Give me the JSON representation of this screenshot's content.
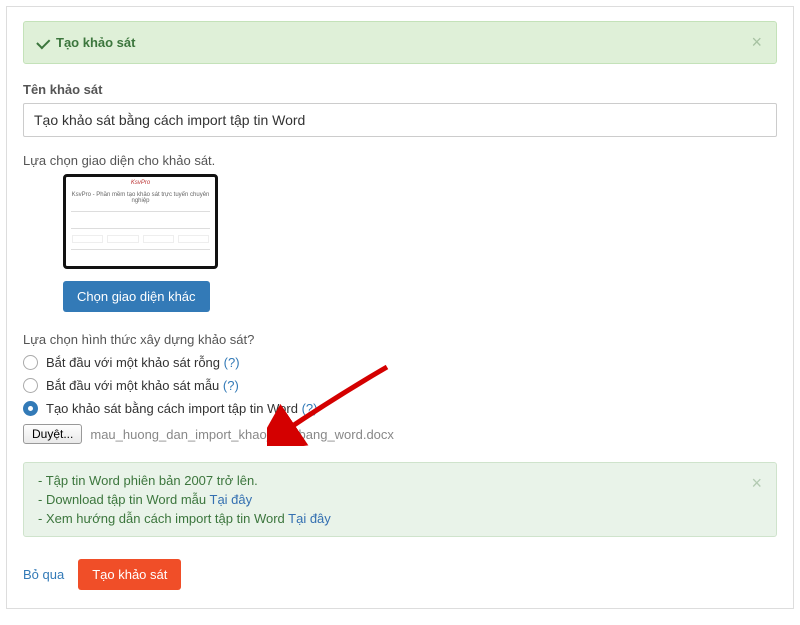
{
  "alert": {
    "title": "Tạo khảo sát"
  },
  "survey_name": {
    "label": "Tên khảo sát",
    "value": "Tạo khảo sát bằng cách import tập tin Word"
  },
  "template": {
    "label": "Lựa chọn giao diện cho khảo sát.",
    "button": "Chọn giao diện khác",
    "thumb_brand": "KsvPro",
    "thumb_title": "KsvPro - Phần mềm tạo khảo sát trực tuyến chuyên nghiệp"
  },
  "build": {
    "label": "Lựa chọn hình thức xây dựng khảo sát?",
    "opt1": "Bắt đầu với một khảo sát rỗng",
    "opt2": "Bắt đầu với một khảo sát mẫu",
    "opt3": "Tạo khảo sát bằng cách import tập tin Word",
    "help": "(?)"
  },
  "file": {
    "browse": "Duyệt...",
    "name": "mau_huong_dan_import_khao_sat_bang_word.docx"
  },
  "info": {
    "line1": "- Tập tin Word phiên bản 2007 trở lên.",
    "line2a": "- Download tập tin Word mẫu ",
    "line2b": "Tại đây",
    "line3a": "- Xem hướng dẫn cách import tập tin Word ",
    "line3b": "Tại đây"
  },
  "footer": {
    "skip": "Bỏ qua",
    "create": "Tạo khảo sát"
  }
}
